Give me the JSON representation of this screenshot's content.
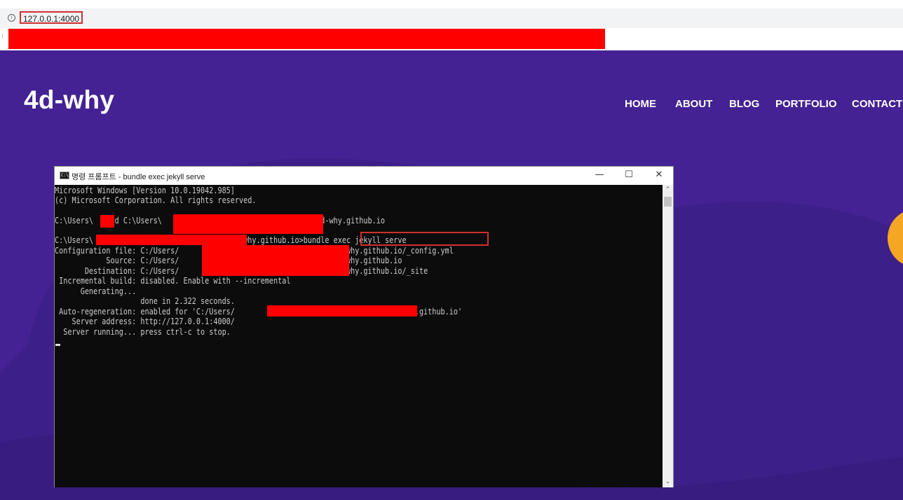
{
  "browser": {
    "url": "127.0.0.1:4000",
    "info_icon": "i"
  },
  "site": {
    "logo": "4d-why",
    "nav": [
      {
        "label": "HOME"
      },
      {
        "label": "ABOUT"
      },
      {
        "label": "BLOG"
      },
      {
        "label": "PORTFOLIO"
      },
      {
        "label": "CONTACT"
      }
    ]
  },
  "terminal": {
    "title": "명령 프롬프트 - bundle  exec jekyll serve",
    "buttons": {
      "minimize": "—",
      "maximize": "☐",
      "close": "✕"
    },
    "lines": [
      "Microsoft Windows [Version 10.0.19042.985]",
      "(c) Microsoft Corporation. All rights reserved.",
      "",
      "C:\\Users\\    cd C:\\Users\\                              \\blog\\4d-why.github.io",
      "",
      "C:\\Users\\                          \\blog\\4d-why.github.io>bundle exec jekyll serve",
      "Configuration file: C:/Users/                              /blog/4d-why.github.io/_config.yml",
      "            Source: C:/Users/                              /blog/4d-why.github.io",
      "       Destination: C:/Users/                              /blog/4d-why.github.io/_site",
      " Incremental build: disabled. Enable with --incremental",
      "      Generating...",
      "                    done in 2.322 seconds.",
      " Auto-regeneration: enabled for 'C:/Users/                              /blog/4d-why.github.io'",
      "    Server address: http://127.0.0.1:4000/",
      "  Server running... press ctrl-c to stop."
    ]
  }
}
